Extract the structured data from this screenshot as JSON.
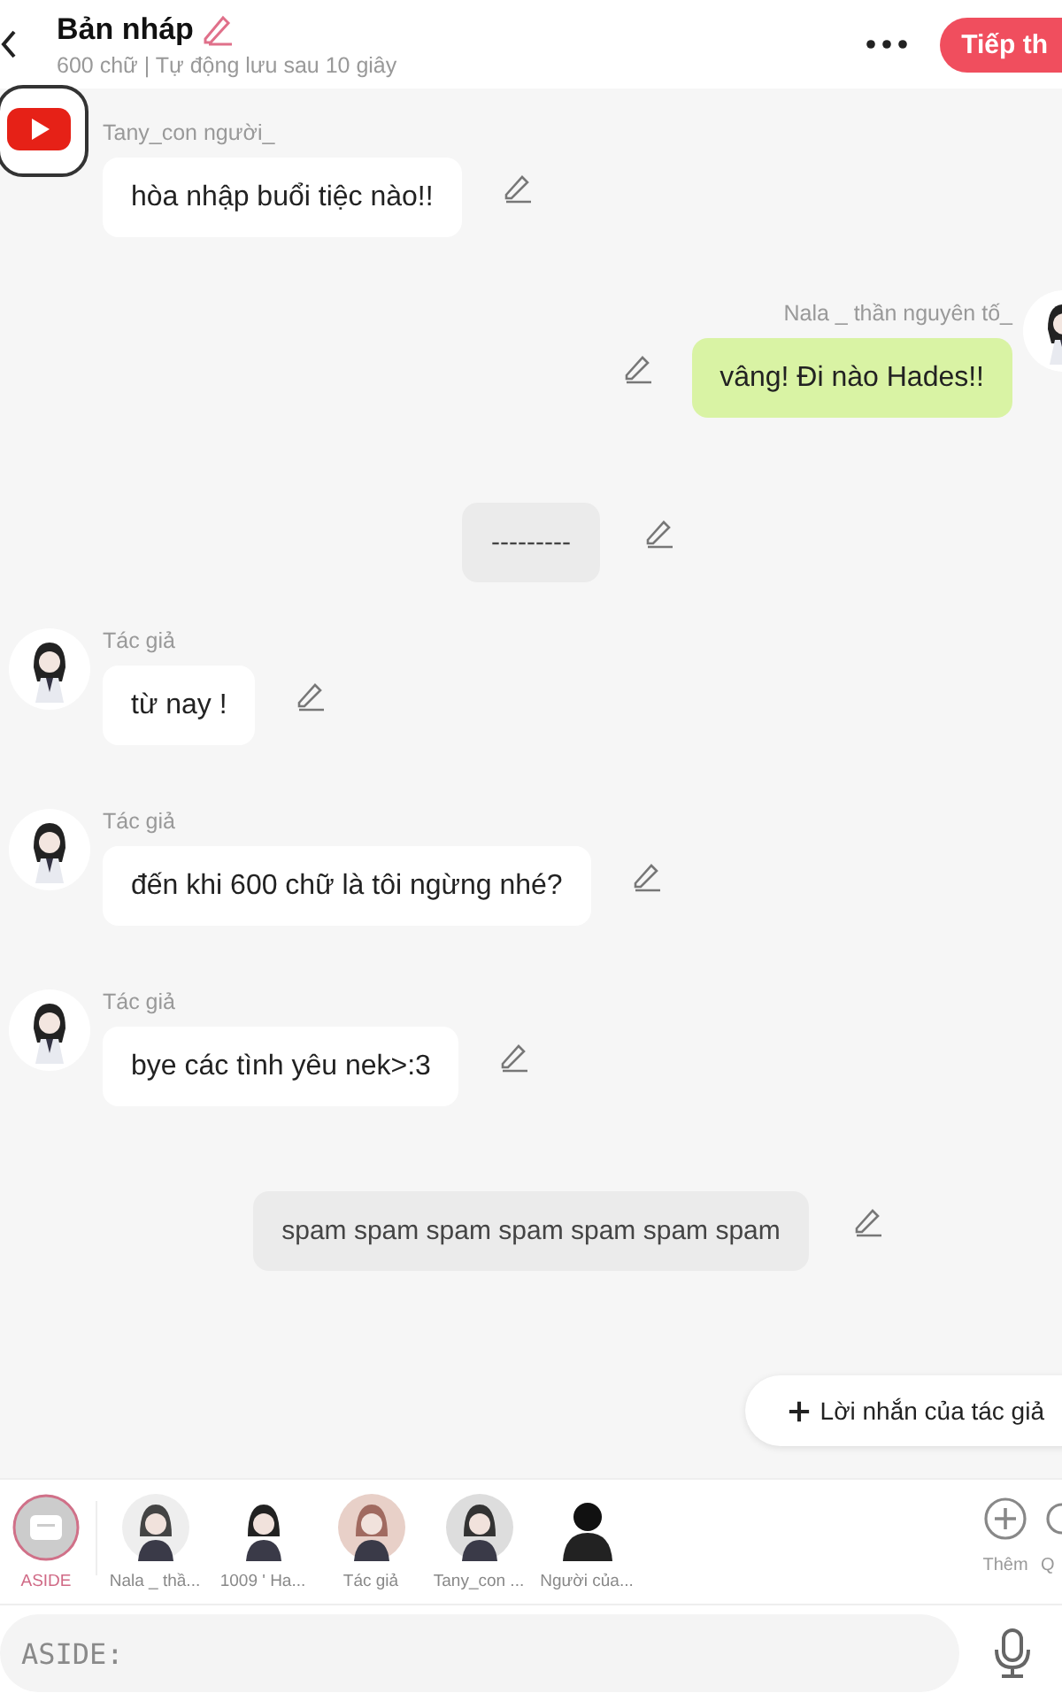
{
  "header": {
    "title": "Bản nháp",
    "subtitle": "600 chữ | Tự động lưu sau 10 giây",
    "next_button": "Tiếp th"
  },
  "messages": [
    {
      "kind": "left",
      "name": "Tany_con người_",
      "text": "hòa nhập buổi tiệc nào!!"
    },
    {
      "kind": "right",
      "name": "Nala _ thần nguyên tố_",
      "text": "vâng! Đi nào Hades!!"
    },
    {
      "kind": "narration",
      "text": "---------"
    },
    {
      "kind": "left",
      "name": "Tác giả",
      "text": "từ nay !"
    },
    {
      "kind": "left",
      "name": "Tác giả",
      "text": "đến khi 600 chữ là tôi ngừng nhé?"
    },
    {
      "kind": "left",
      "name": "Tác giả",
      "text": "bye các tình yêu nek>:3"
    },
    {
      "kind": "narration",
      "text": "spam spam spam spam spam spam spam"
    }
  ],
  "author_note_button": "Lời nhắn của tác giả",
  "characters": [
    {
      "kind": "aside",
      "label": "ASIDE",
      "selected": true
    },
    {
      "kind": "person",
      "label": "Nala _ thầ...",
      "selected": false
    },
    {
      "kind": "person",
      "label": "1009 ' Ha...",
      "selected": false
    },
    {
      "kind": "person",
      "label": "Tác giả",
      "selected": false
    },
    {
      "kind": "person",
      "label": "Tany_con ...",
      "selected": false
    },
    {
      "kind": "silhouette",
      "label": "Người của...",
      "selected": false
    }
  ],
  "actions": [
    {
      "label": "Thêm"
    },
    {
      "label": "Q"
    }
  ],
  "input": {
    "placeholder": "ASIDE:"
  }
}
